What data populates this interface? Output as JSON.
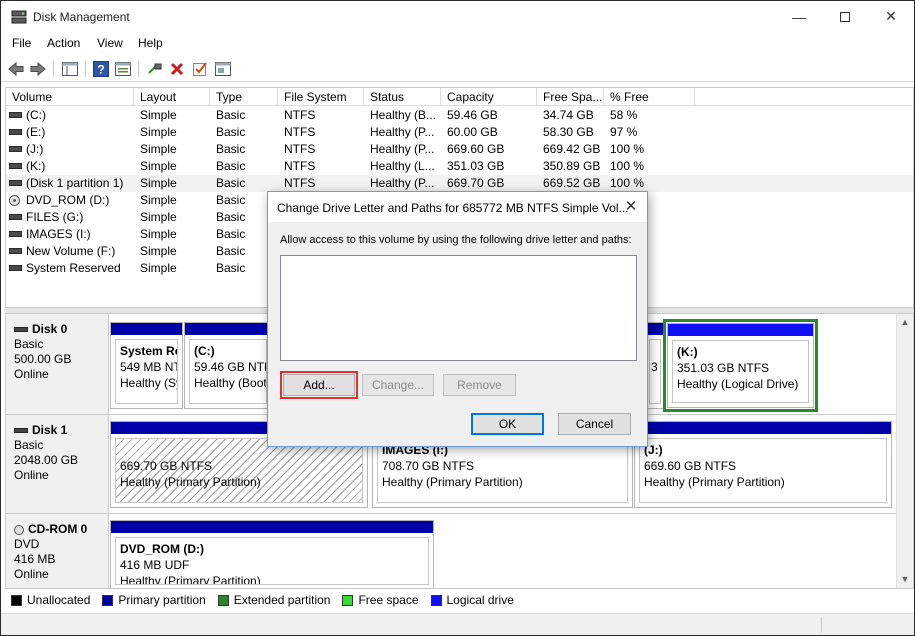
{
  "window": {
    "title": "Disk Management",
    "icon": "disk-management-icon"
  },
  "menu": [
    "File",
    "Action",
    "View",
    "Help"
  ],
  "toolbar_icons": [
    "back-arrow-icon",
    "forward-arrow-icon",
    "console-tree-icon",
    "help-icon",
    "properties-icon",
    "connect-icon",
    "delete-icon",
    "check-icon",
    "settings-icon"
  ],
  "volume_list": {
    "columns": [
      "Volume",
      "Layout",
      "Type",
      "File System",
      "Status",
      "Capacity",
      "Free Spa...",
      "% Free"
    ],
    "rows": [
      {
        "icon": "drive",
        "volume": "(C:)",
        "layout": "Simple",
        "type": "Basic",
        "fs": "NTFS",
        "status": "Healthy (B...",
        "capacity": "59.46 GB",
        "free": "34.74 GB",
        "pct": "58 %"
      },
      {
        "icon": "drive",
        "volume": "(E:)",
        "layout": "Simple",
        "type": "Basic",
        "fs": "NTFS",
        "status": "Healthy (P...",
        "capacity": "60.00 GB",
        "free": "58.30 GB",
        "pct": "97 %"
      },
      {
        "icon": "drive",
        "volume": "(J:)",
        "layout": "Simple",
        "type": "Basic",
        "fs": "NTFS",
        "status": "Healthy (P...",
        "capacity": "669.60 GB",
        "free": "669.42 GB",
        "pct": "100 %"
      },
      {
        "icon": "drive",
        "volume": "(K:)",
        "layout": "Simple",
        "type": "Basic",
        "fs": "NTFS",
        "status": "Healthy (L...",
        "capacity": "351.03 GB",
        "free": "350.89 GB",
        "pct": "100 %"
      },
      {
        "icon": "drive",
        "volume": "(Disk 1 partition 1)",
        "layout": "Simple",
        "type": "Basic",
        "fs": "NTFS",
        "status": "Healthy (P...",
        "capacity": "669.70 GB",
        "free": "669.52 GB",
        "pct": "100 %"
      },
      {
        "icon": "cd",
        "volume": "DVD_ROM (D:)",
        "layout": "Simple",
        "type": "Basic",
        "fs": "",
        "status": "",
        "capacity": "",
        "free": "",
        "pct": ""
      },
      {
        "icon": "drive",
        "volume": "FILES (G:)",
        "layout": "Simple",
        "type": "Basic",
        "fs": "",
        "status": "",
        "capacity": "",
        "free": "",
        "pct": ""
      },
      {
        "icon": "drive",
        "volume": "IMAGES (I:)",
        "layout": "Simple",
        "type": "Basic",
        "fs": "",
        "status": "",
        "capacity": "",
        "free": "",
        "pct": ""
      },
      {
        "icon": "drive",
        "volume": "New Volume (F:)",
        "layout": "Simple",
        "type": "Basic",
        "fs": "",
        "status": "",
        "capacity": "",
        "free": "",
        "pct": ""
      },
      {
        "icon": "drive",
        "volume": "System Reserved",
        "layout": "Simple",
        "type": "Basic",
        "fs": "",
        "status": "",
        "capacity": "",
        "free": "",
        "pct": ""
      }
    ]
  },
  "disks": {
    "disk0": {
      "name": "Disk 0",
      "type": "Basic",
      "size": "500.00 GB",
      "state": "Online",
      "p1": {
        "name": "System Re",
        "l1": "549 MB NT",
        "l2": "Healthy (Sy"
      },
      "p2": {
        "name": "(C:)",
        "l1": "59.46 GB NTFS",
        "l2": "Healthy (Boot,"
      },
      "p3": {
        "l1": "3 ["
      },
      "p4": {
        "name": "(K:)",
        "l1": "351.03 GB NTFS",
        "l2": "Healthy (Logical Drive)"
      }
    },
    "disk1": {
      "name": "Disk 1",
      "type": "Basic",
      "size": "2048.00 GB",
      "state": "Online",
      "p1": {
        "l1": "669.70 GB NTFS",
        "l2": "Healthy (Primary Partition)"
      },
      "p2": {
        "name": "IMAGES (I:)",
        "l1": "708.70 GB NTFS",
        "l2": "Healthy (Primary Partition)"
      },
      "p3": {
        "name": "(J:)",
        "l1": "669.60 GB NTFS",
        "l2": "Healthy (Primary Partition)"
      }
    },
    "cdrom0": {
      "name": "CD-ROM 0",
      "type": "DVD",
      "size": "416 MB",
      "state": "Online",
      "p1": {
        "name": "DVD_ROM  (D:)",
        "l1": "416 MB UDF",
        "l2": "Healthy (Primary Partition)"
      }
    }
  },
  "legend": [
    {
      "label": "Unallocated",
      "color": "#000000"
    },
    {
      "label": "Primary partition",
      "color": "#0000a8"
    },
    {
      "label": "Extended partition",
      "color": "#2a8a2a"
    },
    {
      "label": "Free space",
      "color": "#33dd33"
    },
    {
      "label": "Logical drive",
      "color": "#1010ff"
    }
  ],
  "dialog": {
    "title": "Change Drive Letter and Paths for 685772 MB NTFS Simple Vol...",
    "instruction": "Allow access to this volume by using the following drive letter and paths:",
    "add": "Add...",
    "change": "Change...",
    "remove": "Remove",
    "ok": "OK",
    "cancel": "Cancel"
  }
}
